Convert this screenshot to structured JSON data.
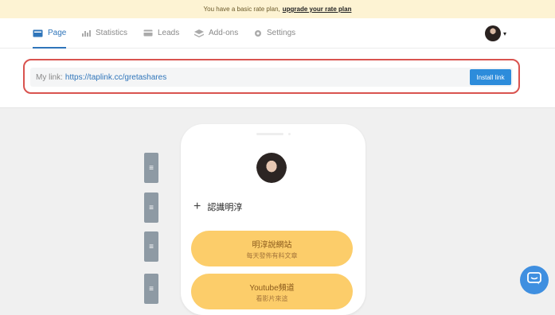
{
  "banner": {
    "text": "You have a basic rate plan,",
    "link": "upgrade your rate plan"
  },
  "nav": {
    "tabs": [
      {
        "label": "Page",
        "icon": "page-icon"
      },
      {
        "label": "Statistics",
        "icon": "bar-chart-icon"
      },
      {
        "label": "Leads",
        "icon": "card-icon"
      },
      {
        "label": "Add-ons",
        "icon": "layers-icon"
      },
      {
        "label": "Settings",
        "icon": "gear-icon"
      }
    ],
    "active_tab": "Page"
  },
  "link_panel": {
    "label": "My link:",
    "url": "https://taplink.cc/gretashares",
    "install_label": "Install link"
  },
  "phone": {
    "title": "認識明淳",
    "buttons": [
      {
        "title": "明淳說網站",
        "subtitle": "每天發佈有料文章"
      },
      {
        "title": "Youtube頻道",
        "subtitle": "看影片來這"
      }
    ]
  },
  "colors": {
    "accent": "#2f75ba",
    "install_button": "#2d8cdb",
    "pill": "#fccd6a",
    "banner": "#fdf3d3",
    "highlight_border": "#d9534f",
    "chat_button": "#3f8fe0"
  }
}
